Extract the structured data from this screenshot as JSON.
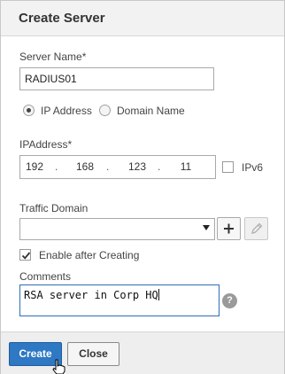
{
  "dialog": {
    "title": "Create Server"
  },
  "server_name": {
    "label": "Server Name*",
    "value": "RADIUS01"
  },
  "address_type": {
    "options": [
      {
        "label": "IP Address",
        "selected": true
      },
      {
        "label": "Domain Name",
        "selected": false
      }
    ]
  },
  "ip_address": {
    "label": "IPAddress*",
    "octets": [
      "192",
      "168",
      "123",
      "11"
    ],
    "dot": ".",
    "ipv6_label": "IPv6",
    "ipv6_checked": false
  },
  "traffic_domain": {
    "label": "Traffic Domain",
    "selected_value": ""
  },
  "enable_after_creating": {
    "label": "Enable after Creating",
    "checked": true
  },
  "comments": {
    "label": "Comments",
    "value": "RSA server in Corp HQ"
  },
  "help": {
    "glyph": "?"
  },
  "footer": {
    "create_label": "Create",
    "close_label": "Close"
  },
  "colors": {
    "primary_button": "#2e78c4",
    "focus_border": "#2f6db5",
    "header_bg": "#f2f2f2",
    "footer_bg": "#eeeeee"
  }
}
